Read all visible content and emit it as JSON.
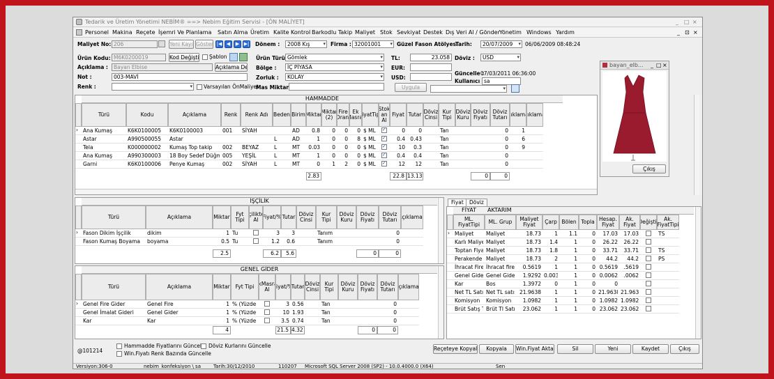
{
  "window": {
    "title": "Tedarik ve Üretim Yönetimi   NEBİM® ==> Nebim Eğitim Servisi - [ÖN MALİYET]",
    "controls": [
      "_",
      "□",
      "×"
    ],
    "inner_controls": [
      "_",
      "⊡",
      "×"
    ]
  },
  "menu": [
    "Personel",
    "Makina",
    "Reçete",
    "İşemri Ve Planlama",
    "Satın Alma",
    "Üretim",
    "Kalite Kontrol",
    "Barkodlu Takip",
    "Maliyet",
    "Stok",
    "Sevkiyat",
    "Destek",
    "Dış Veri Al / Gönder",
    "Yönetim",
    "Windows",
    "Yardım"
  ],
  "header": {
    "maliyet_no_label": "Maliyet No:",
    "maliyet_no": "206",
    "yeni_kayit": "Yeni Kayıt",
    "goster": "Göster",
    "donem_label": "Dönem :",
    "donem": "2008 Kış",
    "firma_label": "Firma :",
    "firma": "32001001",
    "firma_name": "Güzel Fason Atölyesi",
    "tarih_label": "Tarih:",
    "tarih": "20/07/2009",
    "tarih_stamp": "06/06/2009 08:48:24",
    "urun_kodu_label": "Ürün Kodu:",
    "urun_kodu": "M6K0200019",
    "kod_degistir": "Kod Değiştir",
    "sablon": "Şablon",
    "aciklama_label": "Açıklama :",
    "aciklama": "Bayan Elbise",
    "aciklama_degistir": "Açıklama Değ",
    "not_label": "Not :",
    "not": "003-MAVİ",
    "renk_label": "Renk :",
    "renk": "",
    "varsayilan": "Varsayılan ÖnMaliyet",
    "urun_turu_label": "Ürün Türü :",
    "urun_turu": "Gömlek",
    "bolge_label": "Bölge :",
    "bolge": "İÇ PİYASA",
    "zorluk_label": "Zorluk :",
    "zorluk": "KOLAY",
    "mas_miktar_label": "Mas Miktar :",
    "mas_miktar": "",
    "tl_label": "TL:",
    "tl": "23.058",
    "eur_label": "EUR:",
    "eur": "",
    "usd_label": "USD:",
    "usd": "",
    "uygula": "Uygula",
    "doviz_label": "Döviz :",
    "doviz": "USD",
    "guncelle_label": "Güncelle :",
    "guncelle": "07/03/2011 06:36:00",
    "kullanici_label": "Kullanıcı :",
    "kullanici": "sa"
  },
  "image_panel": {
    "title": "bayan_elb...",
    "close_btn": "Çıkış"
  },
  "hammadde": {
    "caption": "HAMMADDE",
    "columns": [
      "Türü",
      "Kodu",
      "Açıklama",
      "Renk",
      "Renk Adı",
      "Beden",
      "Birim",
      "Miktar",
      "Miktar (2)",
      "Fire Oranı",
      "Ek Masraf",
      "FiyatTipi",
      "Stok an Al",
      "Fiyat",
      "Tutar",
      "Döviz Cinsi",
      "Kur Tipi",
      "Döviz Kuru",
      "Döviz Fiyatı",
      "Döviz Tutarı",
      "Açıklama2",
      "Açıklama3"
    ],
    "rows": [
      [
        "Ana Kumaş",
        "K6K0100005",
        "K6K0100003",
        "001",
        "SİYAH",
        "",
        "AD",
        "0.8",
        "0",
        "0",
        "0",
        "$ ML",
        "",
        "0",
        "0",
        "",
        "Tan",
        "",
        "",
        "0",
        "1",
        ""
      ],
      [
        "Astar",
        "A990500055",
        "Astar",
        "",
        "",
        "L",
        "AD",
        "1",
        "0",
        "0",
        "8",
        "$ ML",
        "",
        "0.4",
        "0.43",
        "",
        "Tan",
        "",
        "",
        "0",
        "6",
        ""
      ],
      [
        "Tela",
        "K000000002",
        "Kumaş Top takip",
        "002",
        "BEYAZ",
        "L",
        "MT",
        "0.03",
        "0",
        "0",
        "0",
        "$ ML",
        "",
        "10",
        "0.3",
        "",
        "Tan",
        "",
        "",
        "0",
        "9",
        ""
      ],
      [
        "Ana Kumaş",
        "A990300003",
        "18 Boy Sedef Düğme",
        "005",
        "YEŞİL",
        "L",
        "MT",
        "1",
        "0",
        "0",
        "0",
        "$ ML",
        "",
        "0.4",
        "0.4",
        "",
        "Tan",
        "",
        "",
        "0",
        "",
        ""
      ],
      [
        "Garni",
        "K6K0100006",
        "Penye Kumaş",
        "002",
        "SİYAH",
        "L",
        "MT",
        "0",
        "1",
        "2",
        "0",
        "$ ML",
        "",
        "12",
        "12",
        "",
        "Tan",
        "",
        "",
        "0",
        "",
        ""
      ]
    ],
    "totals": {
      "miktar": "2.83",
      "fiyat": "22.8",
      "tutar": "13.13",
      "doviz_fiyati": "0",
      "doviz_tutari": "0"
    }
  },
  "iscilik": {
    "caption": "İŞÇİLİK",
    "columns": [
      "Türü",
      "Açıklama",
      "Miktar",
      "Fyt Tipi",
      "İşçilikten Al",
      "Fiyat/%",
      "Tutar",
      "Döviz Cinsi",
      "Kur Tipi",
      "Döviz Kuru",
      "Döviz Fiyatı",
      "Döviz Tutarı",
      "Açıklama2"
    ],
    "rows": [
      [
        "Fason Dikim İşçilik",
        "dikim",
        "1",
        "Tu",
        "",
        "3",
        "3",
        "",
        "Tanım",
        "",
        "",
        "0",
        ""
      ],
      [
        "Fason Kumaş Boyama",
        "boyama",
        "0.5",
        "Tu",
        "",
        "1.2",
        "0.6",
        "",
        "Tanım",
        "",
        "",
        "0",
        ""
      ]
    ],
    "totals": {
      "miktar": "2.5",
      "fiyat": "6.2",
      "tutar": "5.6",
      "doviz_fiyati": "0",
      "doviz_tutari": "0"
    }
  },
  "genel_gider": {
    "caption": "GENEL GİDER",
    "columns": [
      "Türü",
      "Açıklama",
      "Miktar",
      "Fyt Tipi",
      "EkMasraf Al",
      "Fiyat/%",
      "Tutar",
      "Döviz Cinsi",
      "Kur Tipi",
      "Döviz Kuru",
      "Döviz Fiyatı",
      "Döviz Tutarı",
      "Açıklama2"
    ],
    "rows": [
      [
        "Genel Fire Gider",
        "Genel Fire",
        "1",
        "% (Yüzde",
        "",
        "3",
        "0.56",
        "",
        "Tan",
        "",
        "",
        "0",
        ""
      ],
      [
        "Genel İmalat Gideri",
        "Genel Gider",
        "1",
        "% (Yüzde",
        "",
        "10",
        "1.93",
        "",
        "Tan",
        "",
        "",
        "0",
        ""
      ],
      [
        "Kar",
        "Kar",
        "1",
        "% (Yüzde",
        "",
        "3.5",
        "0.74",
        "",
        "Tan",
        "",
        "",
        "0",
        ""
      ]
    ],
    "totals": {
      "miktar": "4",
      "fiyat": "21.5",
      "tutar": "4.32",
      "doviz_fiyati": "0",
      "doviz_tutari": "0"
    }
  },
  "fiyat": {
    "tabs": [
      "Fiyat",
      "Döviz"
    ],
    "group_caption": "FİYAT",
    "group_caption2": "AKTARIM",
    "columns": [
      "ML. FiyatTipi",
      "ML. Grup",
      "Maliyet Fiyat",
      "Çarp",
      "Bölen",
      "Topla",
      "Hesap. Fiyat",
      "Ak. Fiyat",
      "Değiştir",
      "Ak. FiyatTipi"
    ],
    "rows": [
      [
        "Maliyet",
        "Maliyet",
        "18.73",
        "1",
        "1.1",
        "0",
        "17.03",
        "17.03",
        "",
        "TS"
      ],
      [
        "Karlı Maliyet",
        "Maliyet",
        "18.73",
        "1.4",
        "1",
        "0",
        "26.22",
        "26.22",
        "",
        ""
      ],
      [
        "Toptan Fiyat",
        "Maliyet",
        "18.73",
        "1.8",
        "1",
        "0",
        "33.71",
        "33.71",
        "",
        "TS"
      ],
      [
        "Perakende F",
        "Maliyet",
        "18.73",
        "2",
        "1",
        "0",
        "44.2",
        "44.2",
        "",
        "PS"
      ],
      [
        "İhracat Fire",
        "İhracat firesi",
        "0.5619",
        "1",
        "1",
        "0",
        "0.5619",
        ".5619",
        "",
        ""
      ],
      [
        "Genel Gider",
        "Genel Gider",
        "1.9292",
        "0.0032",
        "1",
        "0",
        "0.0062",
        ".0062",
        "",
        ""
      ],
      [
        "Kar",
        "Bos",
        "1.3972",
        "0",
        "1",
        "0",
        "0",
        "",
        "",
        ""
      ],
      [
        "Net TL Satış",
        "Net TL satış",
        "21.9638",
        "1",
        "1",
        "0",
        "21.9638",
        "21.9638",
        "",
        ""
      ],
      [
        "Komisyon",
        "Komisyon",
        "1.0982",
        "1",
        "1",
        "0",
        "1.0982",
        "1.0982",
        "",
        ""
      ],
      [
        "Brüt Satış Tl",
        "Brüt Tl Satış",
        "23.062",
        "1",
        "1",
        "0",
        "23.062",
        "23.062",
        "",
        ""
      ]
    ]
  },
  "footer": {
    "code": "@101214",
    "chk_hammadde": "Hammadde Fiyatlarını Güncelle",
    "chk_doviz": "Döviz Kurlarını Güncelle",
    "chk_winfiyat": "Win.Fiyatı Renk Bazında Güncelle",
    "buttons": [
      "Reçeteye Kopyala",
      "Kopyala",
      "Win.Fiyat Aktar",
      "Sil",
      "Yeni",
      "Kaydet",
      "Çıkış"
    ]
  },
  "statusbar": [
    "Versiyon:306-0",
    "nebim_konfeksiyon \\ sa",
    "Tarih:30/12/2010",
    "110207",
    "Microsoft SQL Server 2008 (SP2) - 10.0.4000.0 (X64)",
    "Sen"
  ]
}
